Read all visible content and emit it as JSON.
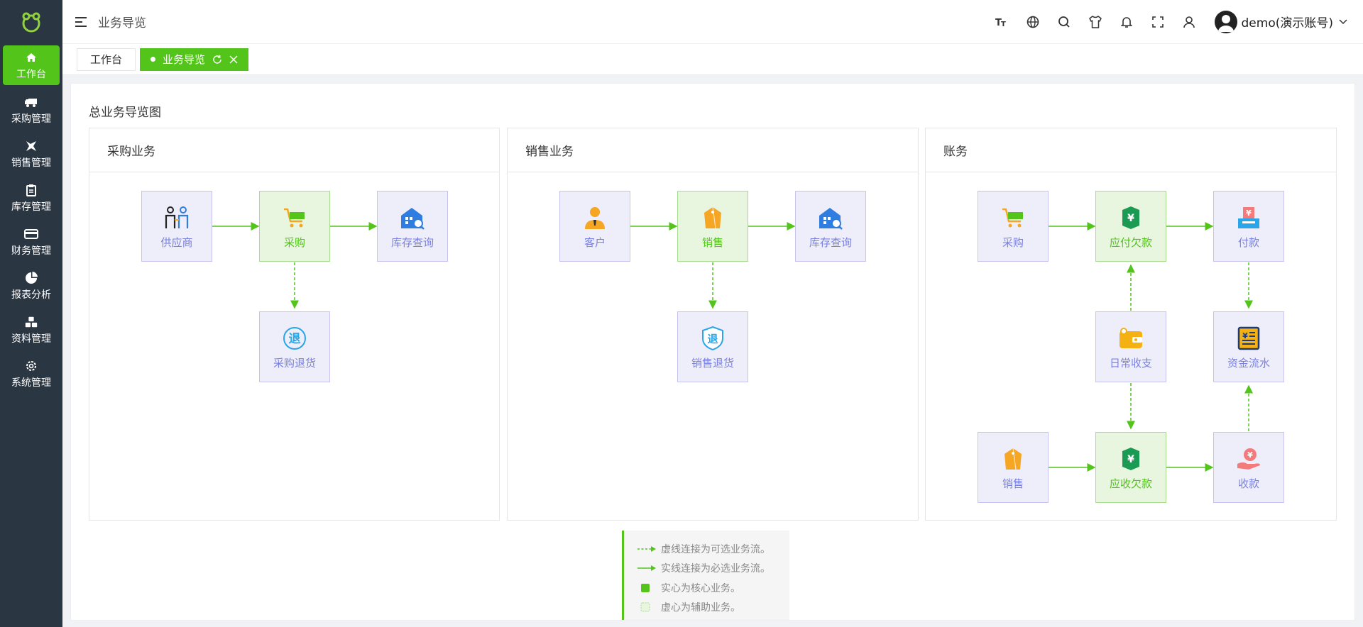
{
  "sidebar": {
    "logo": "frog-logo",
    "items": [
      {
        "label": "工作台",
        "icon": "home-icon"
      },
      {
        "label": "采购管理",
        "icon": "truck-icon"
      },
      {
        "label": "销售管理",
        "icon": "sales-icon"
      },
      {
        "label": "库存管理",
        "icon": "clipboard-icon"
      },
      {
        "label": "财务管理",
        "icon": "card-icon"
      },
      {
        "label": "报表分析",
        "icon": "pie-icon"
      },
      {
        "label": "资料管理",
        "icon": "cubes-icon"
      },
      {
        "label": "系统管理",
        "icon": "gear-icon"
      }
    ]
  },
  "header": {
    "title": "业务导览",
    "icons": [
      "font-size-icon",
      "language-icon",
      "search-icon",
      "theme-icon",
      "bell-icon",
      "fullscreen-icon",
      "user-icon"
    ],
    "user_name": "demo(演示账号)"
  },
  "tabs": [
    {
      "label": "工作台"
    },
    {
      "label": "业务导览"
    }
  ],
  "main": {
    "title": "总业务导览图",
    "panels": [
      {
        "title": "采购业务",
        "nodes": [
          {
            "label": "供应商",
            "core": false,
            "icon": "supplier-icon"
          },
          {
            "label": "采购",
            "core": true,
            "icon": "cart-icon"
          },
          {
            "label": "库存查询",
            "core": false,
            "icon": "warehouse-search-icon"
          },
          {
            "label": "采购退货",
            "core": false,
            "icon": "return-icon"
          }
        ]
      },
      {
        "title": "销售业务",
        "nodes": [
          {
            "label": "客户",
            "core": false,
            "icon": "customer-icon"
          },
          {
            "label": "销售",
            "core": true,
            "icon": "tag-icon"
          },
          {
            "label": "库存查询",
            "core": false,
            "icon": "warehouse-search-icon"
          },
          {
            "label": "销售退货",
            "core": false,
            "icon": "shield-return-icon"
          }
        ]
      },
      {
        "title": "账务",
        "nodes": [
          {
            "label": "采购",
            "core": false,
            "icon": "cart-icon"
          },
          {
            "label": "应付欠款",
            "core": true,
            "icon": "payable-icon"
          },
          {
            "label": "付款",
            "core": false,
            "icon": "pay-icon"
          },
          {
            "label": "日常收支",
            "core": false,
            "icon": "wallet-icon"
          },
          {
            "label": "资金流水",
            "core": false,
            "icon": "ledger-icon"
          },
          {
            "label": "销售",
            "core": false,
            "icon": "tag-icon"
          },
          {
            "label": "应收欠款",
            "core": true,
            "icon": "receivable-icon"
          },
          {
            "label": "收款",
            "core": false,
            "icon": "receive-icon"
          }
        ]
      }
    ],
    "legend": [
      "虚线连接为可选业务流。",
      "实线连接为必选业务流。",
      "实心为核心业务。",
      "虚心为辅助业务。"
    ]
  },
  "colors": {
    "sidebar_bg": "#2b3643",
    "accent": "#52c41a",
    "node_bg": "#eeeefb",
    "node_border": "#c7c5ef",
    "core_bg": "#e8f6e0",
    "node_text": "#7a80e0"
  }
}
